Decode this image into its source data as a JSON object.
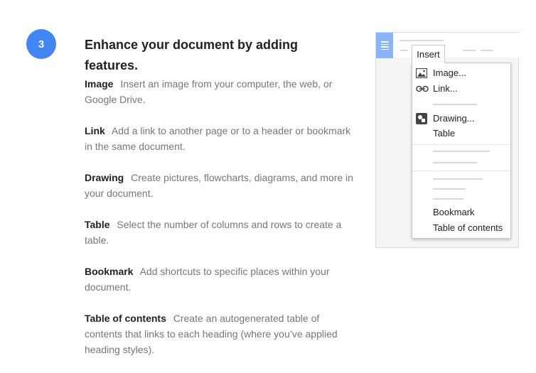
{
  "step": {
    "number": "3"
  },
  "heading": "Enhance your document by adding features.",
  "features": [
    {
      "term": "Image",
      "desc": "Insert an image from your computer, the web, or Google Drive."
    },
    {
      "term": "Link",
      "desc": "Add a link to another page or to a header or bookmark in the same document."
    },
    {
      "term": "Drawing",
      "desc": "Create pictures, flowcharts, diagrams, and more in your document."
    },
    {
      "term": "Table",
      "desc": "Select the number of columns and rows to create a table."
    },
    {
      "term": "Bookmark",
      "desc": "Add shortcuts to specific places within your document."
    },
    {
      "term": "Table of contents",
      "desc": "Create an autogenerated table of contents that links to each heading (where you’ve applied heading styles)."
    }
  ],
  "illustration": {
    "menu_tab": "Insert",
    "menu_items": {
      "image": "Image...",
      "link": "Link...",
      "drawing": "Drawing...",
      "table": "Table",
      "bookmark": "Bookmark",
      "toc": "Table of contents"
    },
    "icons": {
      "doc": "document-icon",
      "image": "image-icon",
      "link": "link-icon",
      "drawing": "drawing-icon"
    }
  },
  "colors": {
    "accent": "#4285f4",
    "doc_icon": "#8ab4f8",
    "text_dark": "#222222",
    "text_muted": "#777777"
  }
}
